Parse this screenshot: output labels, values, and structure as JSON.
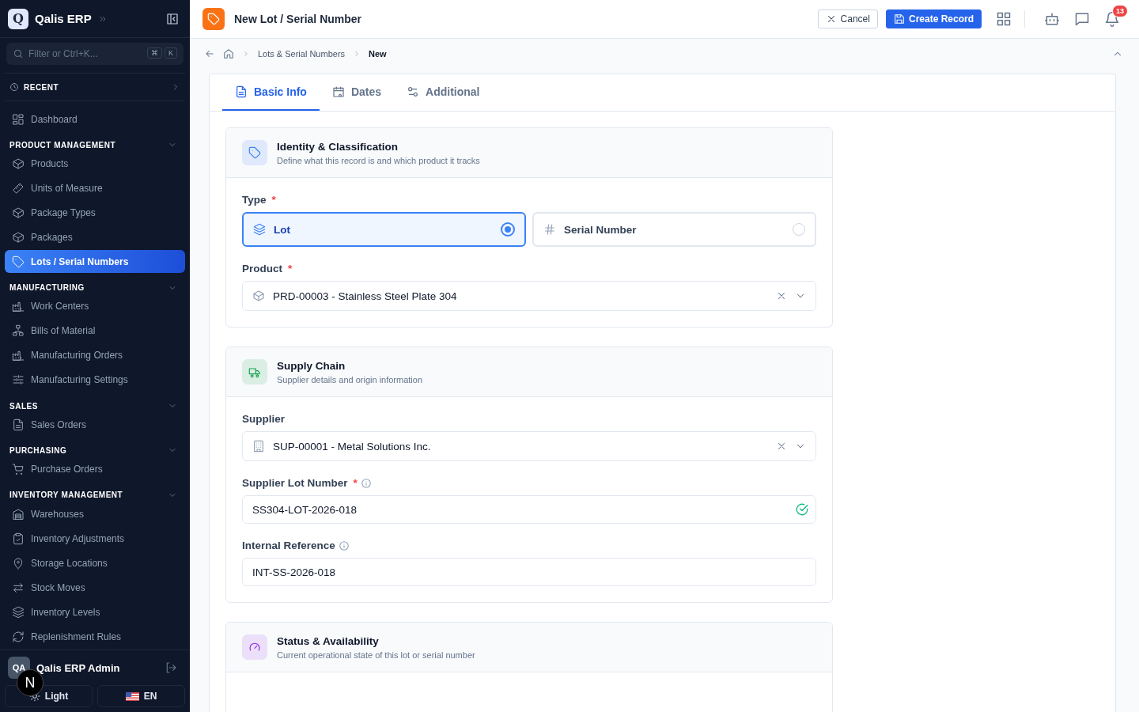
{
  "sidebar": {
    "brand": {
      "logo": "Q",
      "name": "Qalis ERP"
    },
    "search": {
      "placeholder": "Filter or Ctrl+K...",
      "keys": [
        "⌘",
        "K"
      ]
    },
    "recent": {
      "label": "RECENT",
      "expanded": false
    },
    "nav": [
      {
        "kind": "link",
        "label": "Dashboard",
        "selected": false
      },
      {
        "kind": "section",
        "label": "PRODUCT MANAGEMENT",
        "expanded": true,
        "children": [
          {
            "label": "Products",
            "selected": false
          },
          {
            "label": "Units of Measure",
            "selected": false
          },
          {
            "label": "Package Types",
            "selected": false
          },
          {
            "label": "Packages",
            "selected": false
          },
          {
            "label": "Lots / Serial Numbers",
            "selected": true
          }
        ]
      },
      {
        "kind": "section",
        "label": "MANUFACTURING",
        "expanded": true,
        "children": [
          {
            "label": "Work Centers",
            "selected": false
          },
          {
            "label": "Bills of Material",
            "selected": false
          },
          {
            "label": "Manufacturing Orders",
            "selected": false
          },
          {
            "label": "Manufacturing Settings",
            "selected": false
          }
        ]
      },
      {
        "kind": "section",
        "label": "SALES",
        "expanded": true,
        "children": [
          {
            "label": "Sales Orders",
            "selected": false
          }
        ]
      },
      {
        "kind": "section",
        "label": "PURCHASING",
        "expanded": true,
        "children": [
          {
            "label": "Purchase Orders",
            "selected": false
          }
        ]
      },
      {
        "kind": "section",
        "label": "INVENTORY MANAGEMENT",
        "expanded": true,
        "children": [
          {
            "label": "Warehouses",
            "selected": false
          },
          {
            "label": "Inventory Adjustments",
            "selected": false
          },
          {
            "label": "Storage Locations",
            "selected": false
          },
          {
            "label": "Stock Moves",
            "selected": false
          },
          {
            "label": "Inventory Levels",
            "selected": false
          },
          {
            "label": "Replenishment Rules",
            "selected": false
          }
        ]
      }
    ],
    "user": {
      "initials": "QA",
      "name": "Qalis ERP Admin"
    },
    "theme_button": "Light",
    "language_button": "EN"
  },
  "dev_badge": "N",
  "header": {
    "title": "New Lot / Serial Number",
    "buttons": [
      {
        "kind": "outline",
        "label": "Cancel"
      },
      {
        "kind": "primary",
        "label": "Create Record"
      }
    ],
    "notifications": "13"
  },
  "breadcrumb": [
    "Lots & Serial Numbers",
    "New"
  ],
  "tabs": [
    {
      "label": "Basic Info",
      "selected": true
    },
    {
      "label": "Dates",
      "selected": false
    },
    {
      "label": "Additional",
      "selected": false
    }
  ],
  "sections": [
    {
      "title": "Identity & Classification",
      "subtitle": "Define what this record is and which product it tracks",
      "color": "#3b82f6",
      "fields": [
        {
          "kind": "choice",
          "label": "Type",
          "required_mark": "*",
          "options": [
            {
              "label": "Lot",
              "selected": true
            },
            {
              "label": "Serial Number",
              "selected": false
            }
          ]
        },
        {
          "kind": "select",
          "label": "Product",
          "required_mark": "*",
          "value": "PRD-00003 - Stainless Steel Plate 304"
        }
      ]
    },
    {
      "title": "Supply Chain",
      "subtitle": "Supplier details and origin information",
      "color": "#16a34a",
      "fields": [
        {
          "kind": "select",
          "label": "Supplier",
          "value": "SUP-00001 - Metal Solutions Inc."
        },
        {
          "kind": "text",
          "label": "Supplier Lot Number",
          "required_mark": "*",
          "info": true,
          "valid": true,
          "value": "SS304-LOT-2026-018"
        },
        {
          "kind": "text",
          "label": "Internal Reference",
          "info": true,
          "value": "INT-SS-2026-018"
        }
      ]
    },
    {
      "title": "Status & Availability",
      "subtitle": "Current operational state of this lot or serial number",
      "color": "#9333ea"
    }
  ]
}
